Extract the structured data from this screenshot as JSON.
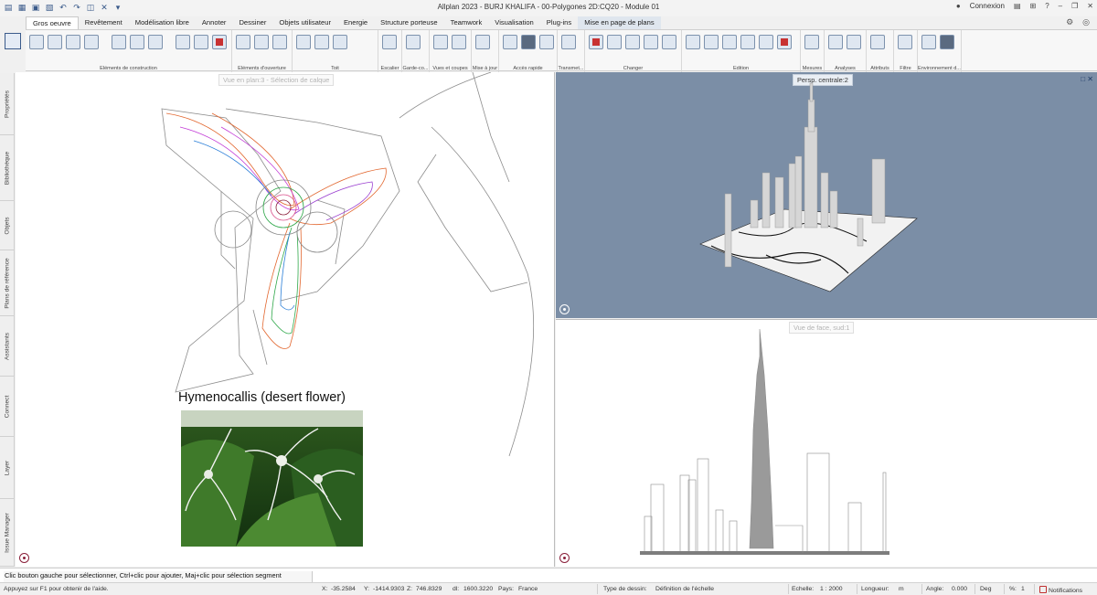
{
  "window": {
    "title": "Allplan 2023 - BURJ KHALIFA - 00-Polygones 2D:CQ20 - Module 01",
    "login": "Connexion"
  },
  "tabs": [
    {
      "label": "Gros oeuvre",
      "active": true
    },
    {
      "label": "Revêtement"
    },
    {
      "label": "Modélisation libre"
    },
    {
      "label": "Annoter"
    },
    {
      "label": "Dessiner"
    },
    {
      "label": "Objets utilisateur"
    },
    {
      "label": "Energie"
    },
    {
      "label": "Structure porteuse"
    },
    {
      "label": "Teamwork"
    },
    {
      "label": "Visualisation"
    },
    {
      "label": "Plug-ins"
    },
    {
      "label": "Mise en page de plans",
      "highlight": true
    }
  ],
  "ribbon_groups": [
    {
      "label": "Eléments de construction"
    },
    {
      "label": "Eléments d'ouverture"
    },
    {
      "label": "Toit"
    },
    {
      "label": "Escalier"
    },
    {
      "label": "Garde-co..."
    },
    {
      "label": "Vues et coupes"
    },
    {
      "label": "Mise à jour"
    },
    {
      "label": "Accès rapide"
    },
    {
      "label": "Transmet..."
    },
    {
      "label": "Changer"
    },
    {
      "label": "Edition"
    },
    {
      "label": "Mesures"
    },
    {
      "label": "Analyses"
    },
    {
      "label": "Attributs"
    },
    {
      "label": "Filtre"
    },
    {
      "label": "Environnement d..."
    }
  ],
  "side_tabs": [
    "Propriétés",
    "Bibliothèque",
    "Objets",
    "Plans de référence",
    "Assistants",
    "Connect",
    "Layer",
    "Issue Manager"
  ],
  "viewports": {
    "plan_label": "Vue en plan:3 - Sélection de calque",
    "persp_label": "Persp. centrale:2",
    "front_label": "Vue de face, sud:1"
  },
  "flower": {
    "caption": "Hymenocallis (desert flower)"
  },
  "command_line": "Clic bouton gauche pour sélectionner, Ctrl+clic pour ajouter, Maj+clic pour sélection segment",
  "status": {
    "help": "Appuyez sur F1 pour obtenir de l'aide.",
    "x_label": "X:",
    "x": "-35.2584",
    "y_label": "Y:",
    "y": "-1414.9303",
    "z_label": "Z:",
    "z": "746.8329",
    "dl_label": "dl:",
    "dl": "1600.3220",
    "country_label": "Pays:",
    "country": "France",
    "drawing_type_label": "Type de dessin:",
    "drawing_type": "Définition de l'échelle",
    "scale_label": "Echelle:",
    "scale": "1 : 2000",
    "length_label": "Longueur:",
    "length": "m",
    "angle_label": "Angle:",
    "angle": "0.000",
    "angle_unit": "Deg",
    "percent_label": "%:",
    "percent": "1",
    "notifications": "Notifications"
  },
  "colors": {
    "accent": "#3a5a8a",
    "persp_bg": "#7b8ea6",
    "plan_curves": [
      "#e2662e",
      "#c23bd6",
      "#2fa84a",
      "#2b7fd8",
      "#9a3fd0",
      "#d94f8a"
    ]
  }
}
